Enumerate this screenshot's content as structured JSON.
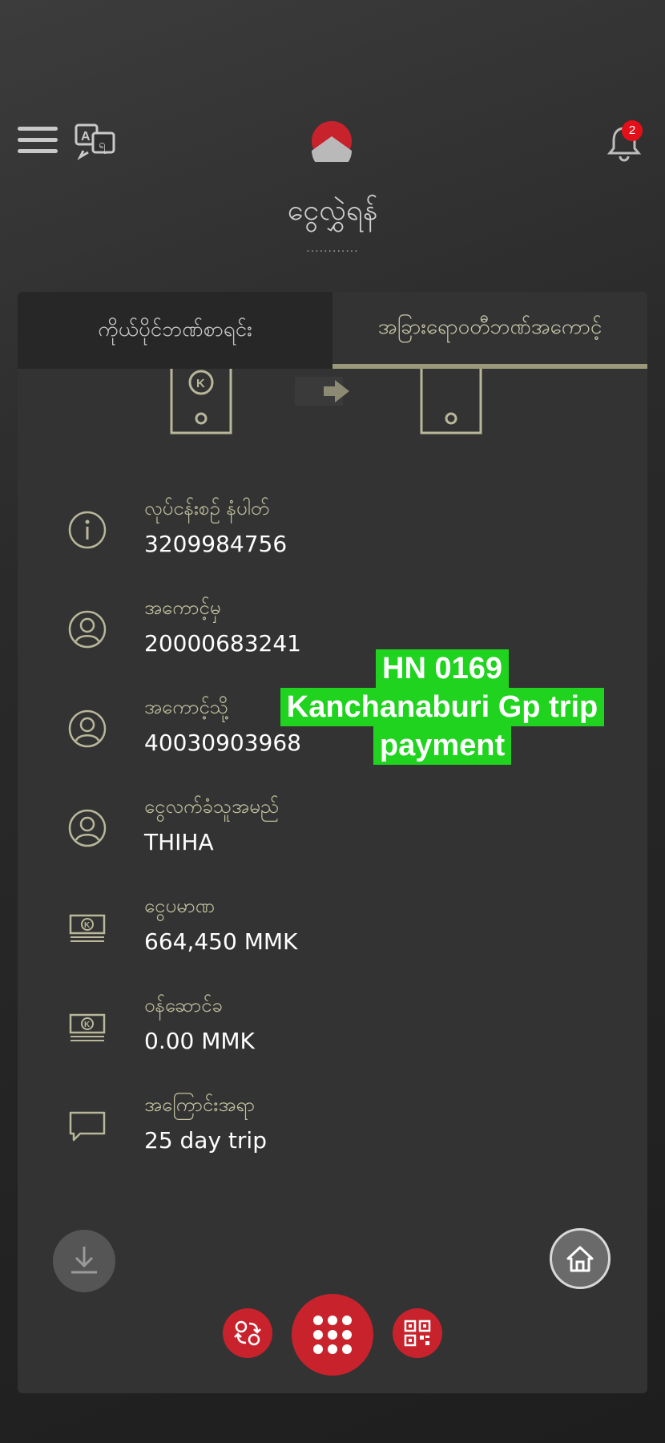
{
  "header": {
    "title": "ငွေလွှဲရန်",
    "title_dots": "............",
    "notification_count": "2"
  },
  "tabs": [
    {
      "label": "ကိုယ်ပိုင်ဘဏ်စာရင်း",
      "active": false
    },
    {
      "label": "အခြားရောဝတီဘဏ်အကောင့်",
      "active": true
    }
  ],
  "details": [
    {
      "icon": "info-icon",
      "label": "လုပ်ငန်းစဉ် နံပါတ်",
      "value": "3209984756"
    },
    {
      "icon": "user-icon",
      "label": "အကောင့်မှ",
      "value": "20000683241"
    },
    {
      "icon": "user-icon",
      "label": "အကောင့်သို့",
      "value": "40030903968"
    },
    {
      "icon": "user-icon",
      "label": "ငွေလက်ခံသူအမည်",
      "value": "THIHA"
    },
    {
      "icon": "money-icon",
      "label": "ငွေပမာဏ",
      "value": "664,450 MMK"
    },
    {
      "icon": "money-icon",
      "label": "ဝန်ဆောင်ခ",
      "value": "0.00 MMK"
    },
    {
      "icon": "comment-icon",
      "label": "အကြောင်းအရာ",
      "value": "25 day trip"
    }
  ],
  "overlay_note": {
    "line1": "HN 0169",
    "line2": "Kanchanaburi Gp trip",
    "line3": "payment"
  },
  "colors": {
    "accent_red": "#c8232c",
    "label_olive": "#c2c09e",
    "note_green": "#1fd31f"
  }
}
